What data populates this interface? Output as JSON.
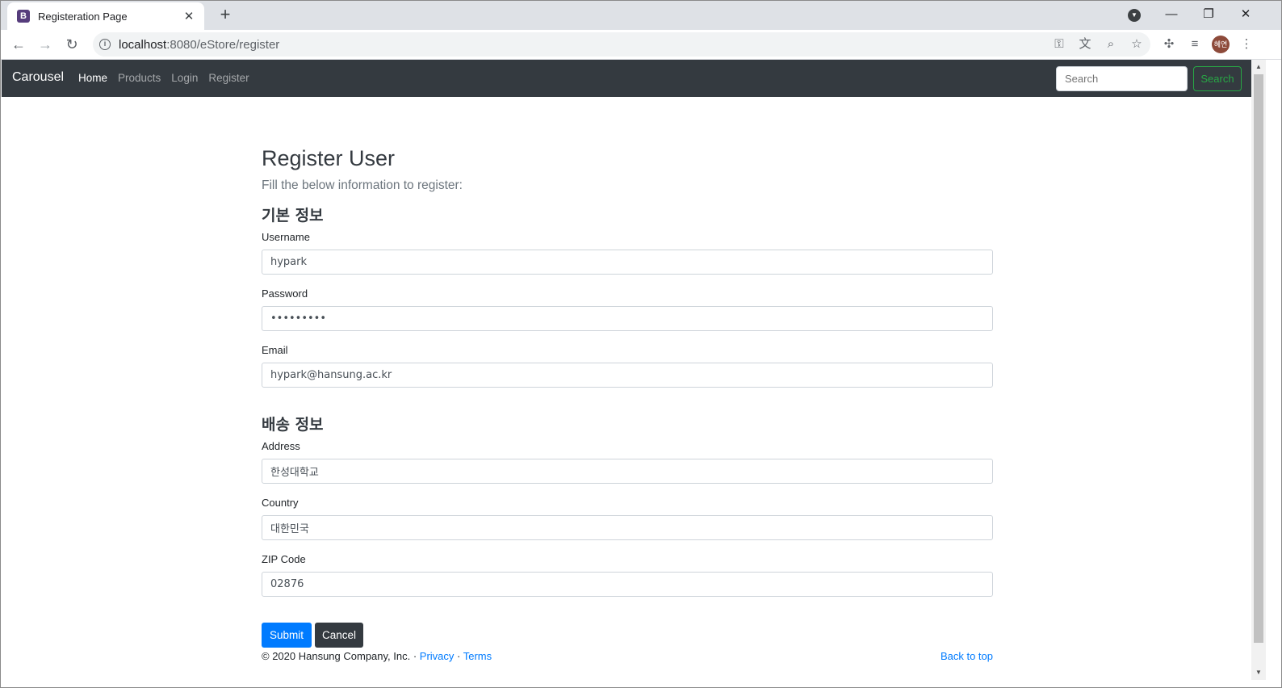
{
  "browser": {
    "tab_title": "Registeration Page",
    "favicon_letter": "B",
    "url_host": "localhost",
    "url_path": ":8080/eStore/register",
    "avatar_text": "혜연"
  },
  "navbar": {
    "brand": "Carousel",
    "links": [
      "Home",
      "Products",
      "Login",
      "Register"
    ],
    "search_placeholder": "Search",
    "search_button": "Search"
  },
  "form": {
    "title": "Register User",
    "lead": "Fill the below information to register:",
    "basic_section": "기본 정보",
    "shipping_section": "배송 정보",
    "username_label": "Username",
    "username_value": "hypark",
    "password_label": "Password",
    "password_value": "•••••••••",
    "email_label": "Email",
    "email_value": "hypark@hansung.ac.kr",
    "address_label": "Address",
    "address_value": "한성대학교",
    "country_label": "Country",
    "country_value": "대한민국",
    "zip_label": "ZIP Code",
    "zip_value": "02876",
    "submit": "Submit",
    "cancel": "Cancel"
  },
  "footer": {
    "copyright": "© 2020 Hansung Company, Inc. · ",
    "privacy": "Privacy",
    "sep": " · ",
    "terms": "Terms",
    "back_to_top": "Back to top"
  }
}
